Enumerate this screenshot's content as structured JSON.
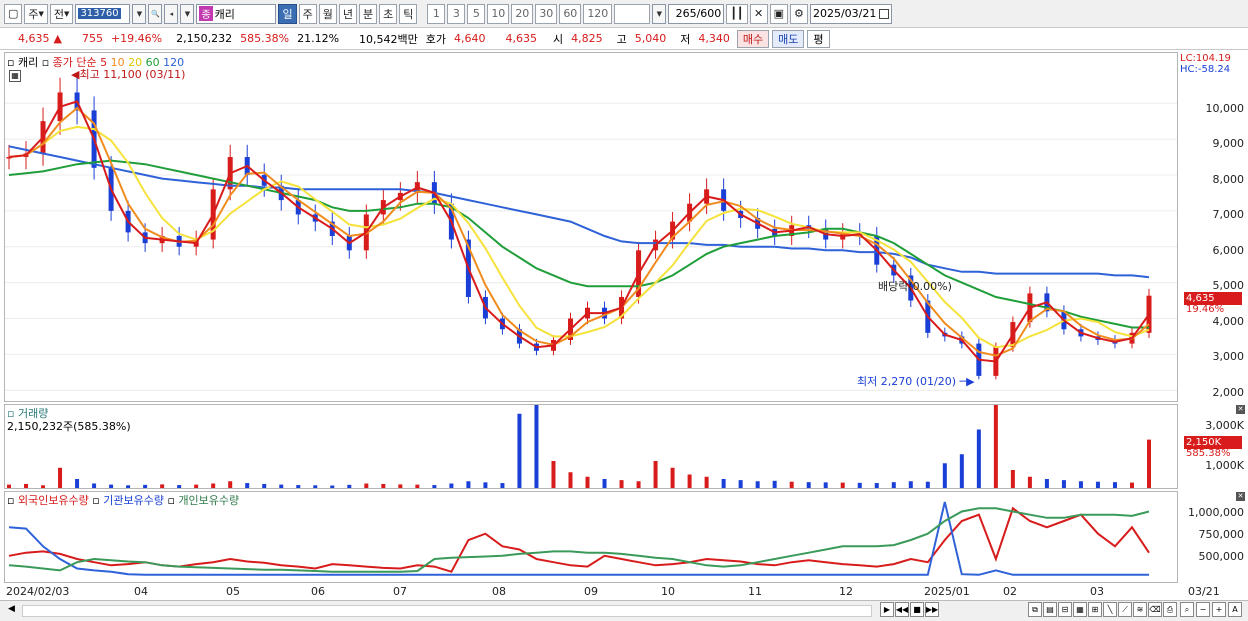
{
  "toolbar": {
    "period_label": "주",
    "prev_label": "전",
    "code": "313760",
    "stock_name": "캐리",
    "stock_badge": "종",
    "tab_day": "일",
    "tab_week": "주",
    "tab_month": "월",
    "tab_year": "년",
    "tab_minute": "분",
    "tab_second": "초",
    "tab_tick": "틱",
    "intervals": [
      "1",
      "3",
      "5",
      "10",
      "20",
      "30",
      "60",
      "120"
    ],
    "count": "265/600",
    "date": "2025/03/21"
  },
  "quote": {
    "price": "4,635",
    "change_arrow": "▲",
    "change": "755",
    "change_pct": "+19.46%",
    "volume": "2,150,232",
    "volume_ratio": "585.38%",
    "turnover": "21.12%",
    "amount": "10,542백만",
    "hoga_label": "호가",
    "ask": "4,640",
    "bid": "4,635",
    "open_label": "시",
    "open": "4,825",
    "high_label": "고",
    "high": "5,040",
    "low_label": "저",
    "low": "4,340",
    "buy_label": "매수",
    "sell_label": "매도",
    "even_label": "평"
  },
  "price_pane": {
    "stock_name": "캐리",
    "legend_title": "종가 단순",
    "ma_periods": [
      "5",
      "10",
      "20",
      "60",
      "120"
    ],
    "max_note": "최고 11,100 (03/11)",
    "min_note": "최저 2,270 (01/20)",
    "dividend_note": "배당락(0.00%)",
    "lc": "LC:104.19",
    "hc": "HC:-58.24",
    "price_flag": "4,635",
    "pct_flag": "19.46%"
  },
  "volume_pane": {
    "title": "거래량",
    "summary": "2,150,232주(585.38%)",
    "flag": "2,150K",
    "pct": "585.38%"
  },
  "holding_pane": {
    "legend": [
      "외국인보유수량",
      "기관보유수량",
      "개인보유수량"
    ]
  },
  "x_labels": [
    "2024/02/03",
    "04",
    "05",
    "06",
    "07",
    "08",
    "09",
    "10",
    "11",
    "12",
    "2025/01",
    "02",
    "03",
    "03/21"
  ],
  "colors": {
    "up": "#d81b1b",
    "down": "#1a3fd6",
    "ma5": "#d81b1b",
    "ma10": "#f08c1e",
    "ma20": "#f5e23a",
    "ma60": "#1f9e3a",
    "ma120": "#2f62d8",
    "foreign": "#d81b1b",
    "institution": "#2f62d8",
    "individual": "#3a9a5a"
  },
  "chart_data": [
    {
      "type": "candlestick",
      "y_ticks": [
        "10,000",
        "9,000",
        "8,000",
        "7,000",
        "6,000",
        "5,000",
        "4,000",
        "3,000",
        "2,000"
      ],
      "ylim": [
        1700,
        11400
      ],
      "close": [
        8500,
        8600,
        9500,
        10300,
        9800,
        8200,
        7000,
        6400,
        6100,
        6300,
        6000,
        6200,
        7600,
        8500,
        8000,
        7700,
        7300,
        6900,
        6700,
        6300,
        5900,
        6900,
        7300,
        7500,
        7800,
        7200,
        6200,
        4600,
        4000,
        3700,
        3300,
        3100,
        3400,
        4000,
        4300,
        4000,
        4600,
        5900,
        6200,
        6700,
        7200,
        7600,
        7000,
        6800,
        6500,
        6300,
        6600,
        6500,
        6200,
        6400,
        6300,
        5500,
        5200,
        4500,
        3600,
        3500,
        3300,
        2400,
        3200,
        3900,
        4700,
        4200,
        3700,
        3500,
        3400,
        3300,
        3600,
        4635
      ],
      "ma_note": "closing-price simple moving averages 5/10/20/60/120 computed from close",
      "ma120": [
        8800,
        8700,
        8600,
        8500,
        8400,
        8300,
        8200,
        8100,
        8000,
        7900,
        7850,
        7800,
        7750,
        7700,
        7700,
        7650,
        7650,
        7600,
        7600,
        7600,
        7600,
        7600,
        7600,
        7600,
        7550,
        7500,
        7400,
        7300,
        7200,
        7100,
        7000,
        6900,
        6800,
        6700,
        6500,
        6300,
        6150,
        6100,
        6100,
        6100,
        6100,
        6050,
        6050,
        6000,
        6000,
        6000,
        5950,
        5950,
        5900,
        5900,
        5850,
        5850,
        5800,
        5700,
        5500,
        5400,
        5300,
        5300,
        5250,
        5250,
        5250,
        5250,
        5250,
        5250,
        5250,
        5200,
        5200,
        5150
      ],
      "ma60": [
        8000,
        8050,
        8100,
        8200,
        8300,
        8350,
        8400,
        8350,
        8300,
        8200,
        8100,
        8000,
        7900,
        7800,
        7700,
        7600,
        7500,
        7400,
        7300,
        7100,
        7000,
        7000,
        7050,
        7100,
        7200,
        7200,
        7100,
        6800,
        6400,
        6000,
        5700,
        5400,
        5200,
        5000,
        4900,
        4900,
        4900,
        4900,
        5000,
        5200,
        5500,
        5800,
        6000,
        6100,
        6200,
        6300,
        6350,
        6400,
        6500,
        6500,
        6400,
        6300,
        6100,
        5800,
        5500,
        5200,
        5000,
        4800,
        4600,
        4500,
        4400,
        4300,
        4200,
        4050,
        3950,
        3850,
        3750,
        3750
      ]
    },
    {
      "type": "bar",
      "ylim": [
        0,
        3600
      ],
      "y_ticks": [
        "3,000K",
        "2,000K",
        "1,000K"
      ],
      "values": [
        150,
        180,
        120,
        900,
        400,
        200,
        150,
        120,
        140,
        160,
        130,
        150,
        200,
        300,
        220,
        180,
        150,
        130,
        120,
        110,
        140,
        200,
        180,
        160,
        150,
        130,
        200,
        300,
        250,
        220,
        3300,
        3800,
        1200,
        700,
        500,
        400,
        350,
        300,
        1200,
        900,
        600,
        500,
        400,
        350,
        300,
        320,
        280,
        260,
        250,
        240,
        230,
        220,
        260,
        300,
        280,
        1100,
        1500,
        2600,
        3700,
        800,
        500,
        400,
        350,
        300,
        280,
        260,
        240,
        2150
      ]
    },
    {
      "type": "line",
      "ylim": [
        0,
        1200000
      ],
      "y_ticks": [
        "1,000,000",
        "750,000",
        "500,000"
      ],
      "series": [
        {
          "name": "외국인보유수량",
          "values": [
            350000,
            400000,
            420000,
            380000,
            300000,
            250000,
            200000,
            220000,
            250000,
            200000,
            180000,
            220000,
            250000,
            300000,
            260000,
            240000,
            200000,
            180000,
            150000,
            220000,
            200000,
            180000,
            160000,
            150000,
            200000,
            180000,
            100000,
            600000,
            700000,
            500000,
            450000,
            300000,
            250000,
            200000,
            180000,
            350000,
            300000,
            250000,
            200000,
            220000,
            250000,
            300000,
            280000,
            260000,
            220000,
            200000,
            250000,
            280000,
            250000,
            220000,
            200000,
            180000,
            220000,
            300000,
            250000,
            600000,
            900000,
            1000000,
            300000,
            1100000,
            900000,
            800000,
            900000,
            1000000,
            700000,
            500000,
            800000,
            400000
          ]
        },
        {
          "name": "기관보유수량",
          "values": [
            800000,
            780000,
            500000,
            300000,
            150000,
            120000,
            100000,
            60000,
            50000,
            50000,
            50000,
            50000,
            50000,
            50000,
            50000,
            50000,
            50000,
            50000,
            50000,
            50000,
            50000,
            50000,
            50000,
            50000,
            50000,
            50000,
            50000,
            50000,
            50000,
            50000,
            50000,
            50000,
            50000,
            50000,
            50000,
            50000,
            50000,
            50000,
            50000,
            50000,
            50000,
            50000,
            50000,
            50000,
            50000,
            50000,
            50000,
            50000,
            50000,
            50000,
            50000,
            50000,
            50000,
            50000,
            50000,
            1200000,
            60000,
            50000,
            120000,
            50000,
            50000,
            50000,
            50000,
            50000,
            50000,
            50000,
            50000,
            50000
          ]
        },
        {
          "name": "개인보유수량",
          "values": [
            200000,
            180000,
            150000,
            120000,
            250000,
            300000,
            280000,
            260000,
            250000,
            200000,
            180000,
            170000,
            160000,
            150000,
            140000,
            130000,
            130000,
            120000,
            110000,
            100000,
            100000,
            100000,
            100000,
            100000,
            110000,
            300000,
            320000,
            330000,
            340000,
            350000,
            380000,
            400000,
            420000,
            420000,
            400000,
            400000,
            380000,
            350000,
            320000,
            300000,
            250000,
            200000,
            180000,
            200000,
            250000,
            300000,
            350000,
            400000,
            450000,
            500000,
            500000,
            500000,
            520000,
            600000,
            700000,
            900000,
            1050000,
            1100000,
            1100000,
            1050000,
            1000000,
            950000,
            950000,
            1000000,
            1000000,
            1000000,
            980000,
            1050000
          ]
        }
      ]
    }
  ]
}
